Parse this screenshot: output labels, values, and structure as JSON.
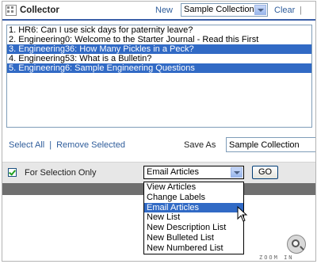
{
  "header": {
    "title": "Collector",
    "new_label": "New",
    "collection_select": "Sample Collection",
    "clear_label": "Clear",
    "separator": "|"
  },
  "list": {
    "items": [
      {
        "text": "1. HR6: Can I use sick days for paternity leave?",
        "selected": false
      },
      {
        "text": "2. Engineering0: Welcome to the Starter Journal - Read this First",
        "selected": false
      },
      {
        "text": "3. Engineering36: How Many Pickles in a Peck?",
        "selected": true
      },
      {
        "text": "4. Engineering53: What is a Bulletin?",
        "selected": false
      },
      {
        "text": "5. Engineering6: Sample Engineering Questions",
        "selected": true
      }
    ]
  },
  "actions": {
    "select_all": "Select All",
    "separator": "|",
    "remove_selected": "Remove Selected",
    "save_as_label": "Save As",
    "save_as_value": "Sample Collection"
  },
  "selection": {
    "for_selection_only": "For Selection Only",
    "checked": true,
    "action_select": "Email Articles",
    "go_label": "GO"
  },
  "dropdown": {
    "options": [
      {
        "text": "View Articles",
        "highlighted": false
      },
      {
        "text": "Change Labels",
        "highlighted": false
      },
      {
        "text": "Email Articles",
        "highlighted": true
      },
      {
        "text": "New List",
        "highlighted": false
      },
      {
        "text": "New Description List",
        "highlighted": false
      },
      {
        "text": "New Bulleted List",
        "highlighted": false
      },
      {
        "text": "New Numbered List",
        "highlighted": false
      }
    ]
  },
  "zoom": {
    "label": "ZOOM IN",
    "icon": "magnifier-icon"
  },
  "colors": {
    "selection": "#316ac5",
    "link": "#2f5d9b",
    "header_rule": "#3a5fa8"
  }
}
